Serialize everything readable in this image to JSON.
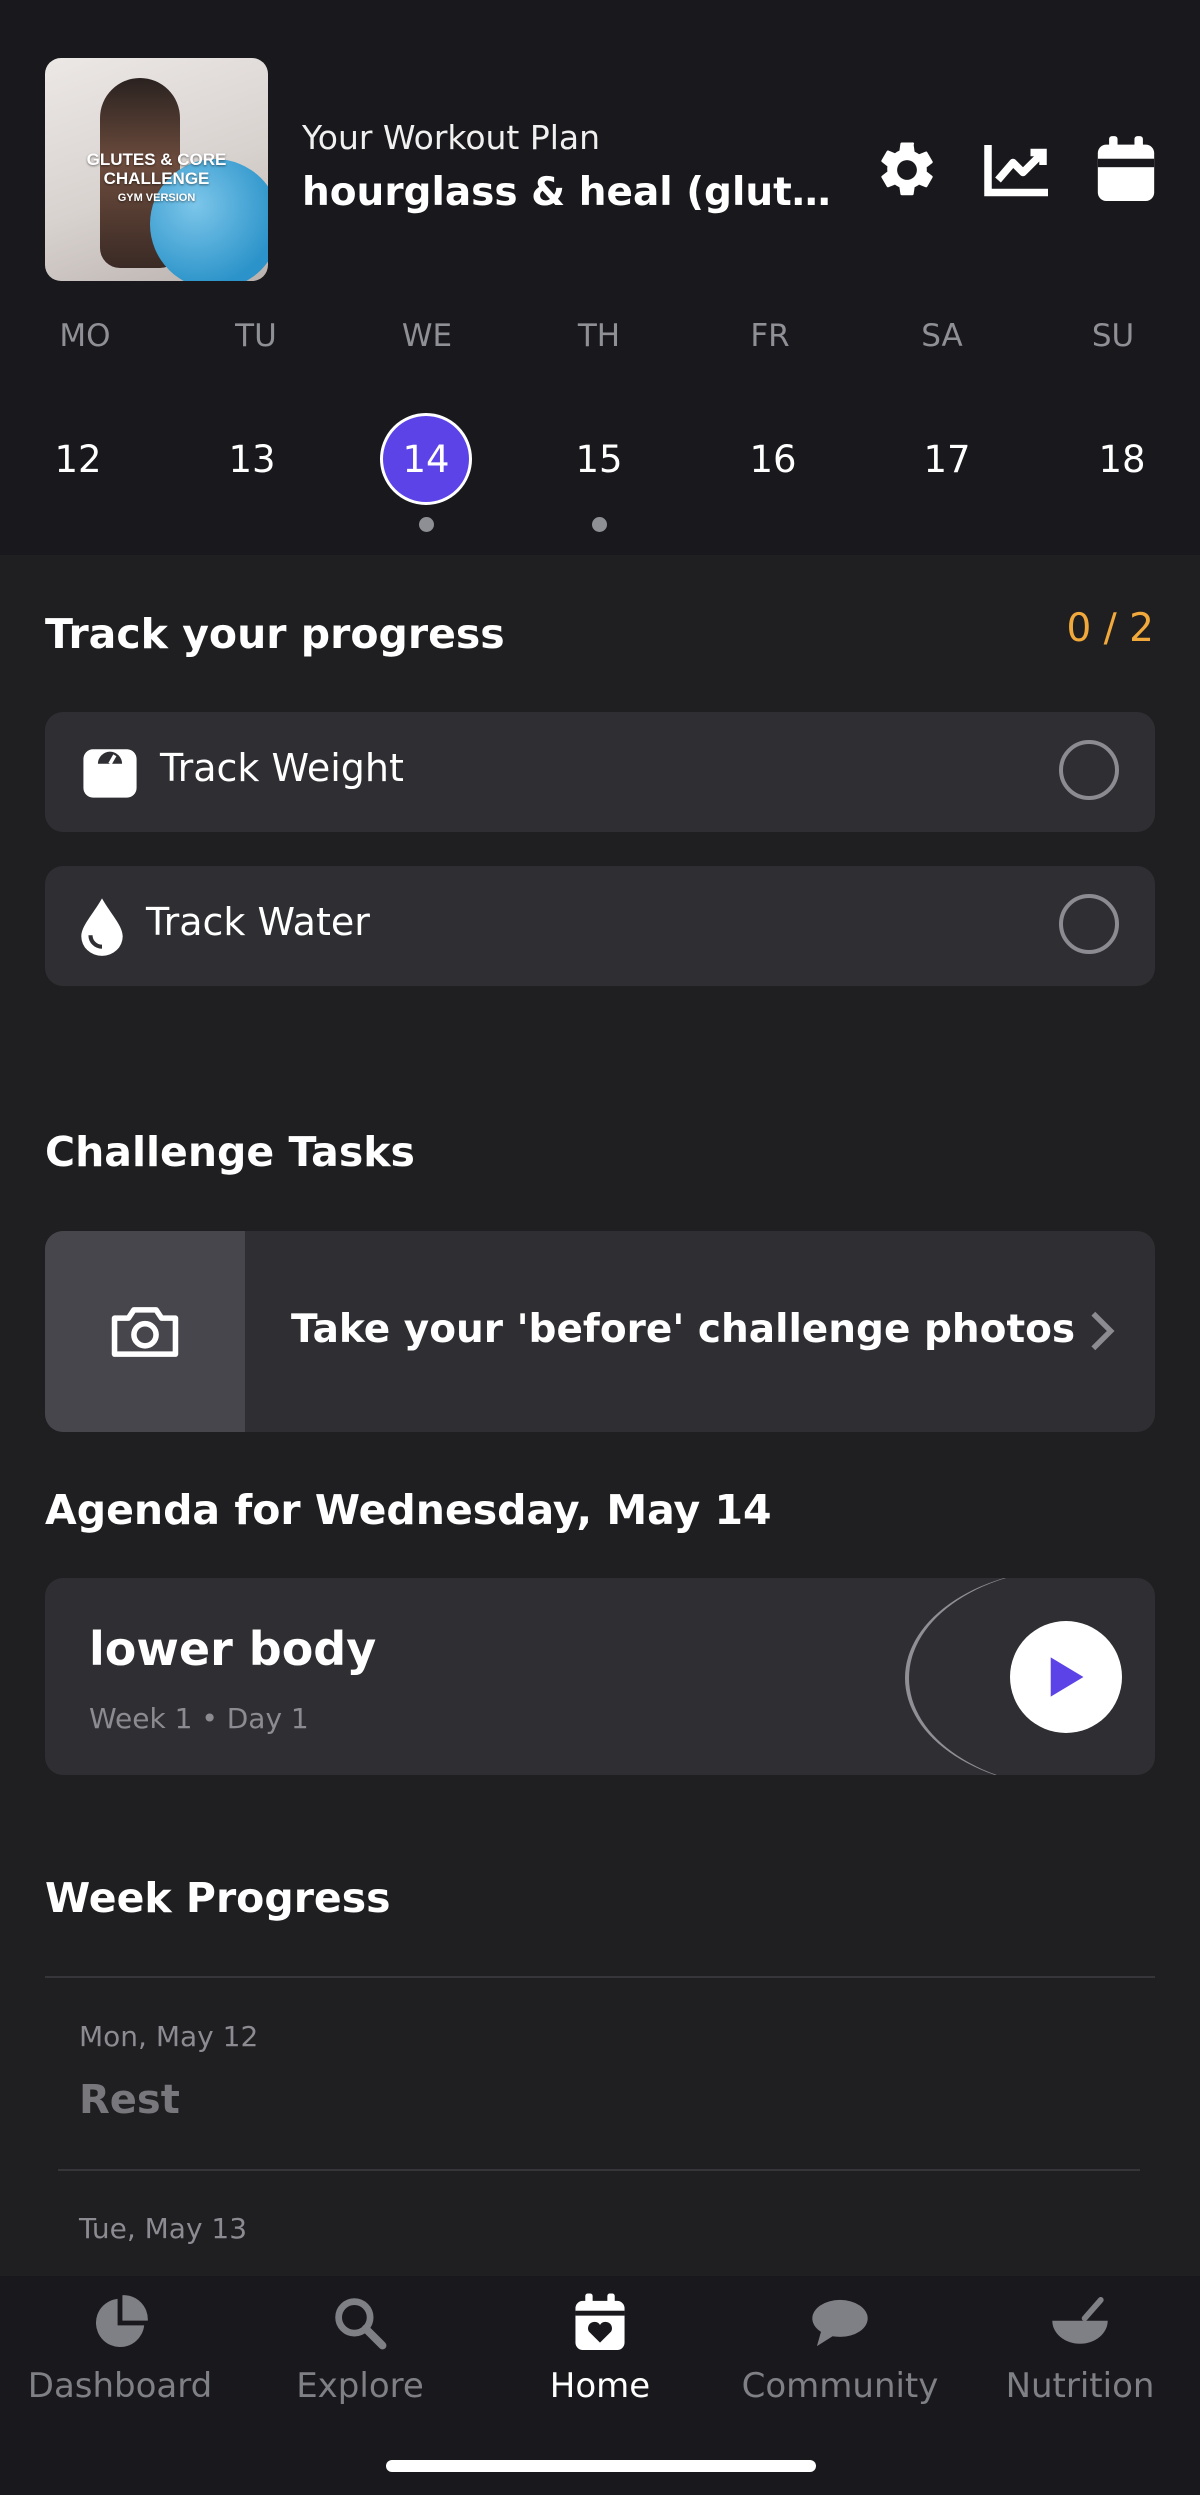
{
  "header": {
    "thumbnail": {
      "line1": "GLUTES & CORE CHALLENGE",
      "line2": "GYM VERSION"
    },
    "plan_label": "Your Workout Plan",
    "plan_title": "hourglass & heal (glutes & core)",
    "icons": [
      "gear-icon",
      "chart-icon",
      "calendar-icon"
    ]
  },
  "week": {
    "days": [
      "MO",
      "TU",
      "WE",
      "TH",
      "FR",
      "SA",
      "SU"
    ],
    "dates": [
      "12",
      "13",
      "14",
      "15",
      "16",
      "17",
      "18"
    ],
    "selected_date": "14",
    "dots_on": [
      "14",
      "15"
    ]
  },
  "track": {
    "title": "Track your progress",
    "count": "0 / 2",
    "items": [
      {
        "label": "Track Weight",
        "icon": "scale-icon"
      },
      {
        "label": "Track Water",
        "icon": "water-drop-icon"
      }
    ]
  },
  "challenge": {
    "title": "Challenge Tasks",
    "task": "Take your 'before' challenge photos"
  },
  "agenda": {
    "title": "Agenda for Wednesday, May 14",
    "workout": "lower body",
    "sub": "Week 1 • Day 1"
  },
  "week_progress": {
    "title": "Week Progress",
    "entries": [
      {
        "date": "Mon, May 12",
        "status": "Rest"
      },
      {
        "date": "Tue, May 13",
        "status": ""
      }
    ]
  },
  "tabs": [
    {
      "label": "Dashboard",
      "icon": "pie-chart-icon"
    },
    {
      "label": "Explore",
      "icon": "search-icon"
    },
    {
      "label": "Home",
      "icon": "calendar-heart-icon"
    },
    {
      "label": "Community",
      "icon": "chat-bubble-icon"
    },
    {
      "label": "Nutrition",
      "icon": "bowl-icon"
    }
  ],
  "active_tab": "Home",
  "colors": {
    "accent": "#5b43e8",
    "count": "#f1a93b",
    "background": "#1f1f21",
    "card": "#2f2f33"
  }
}
